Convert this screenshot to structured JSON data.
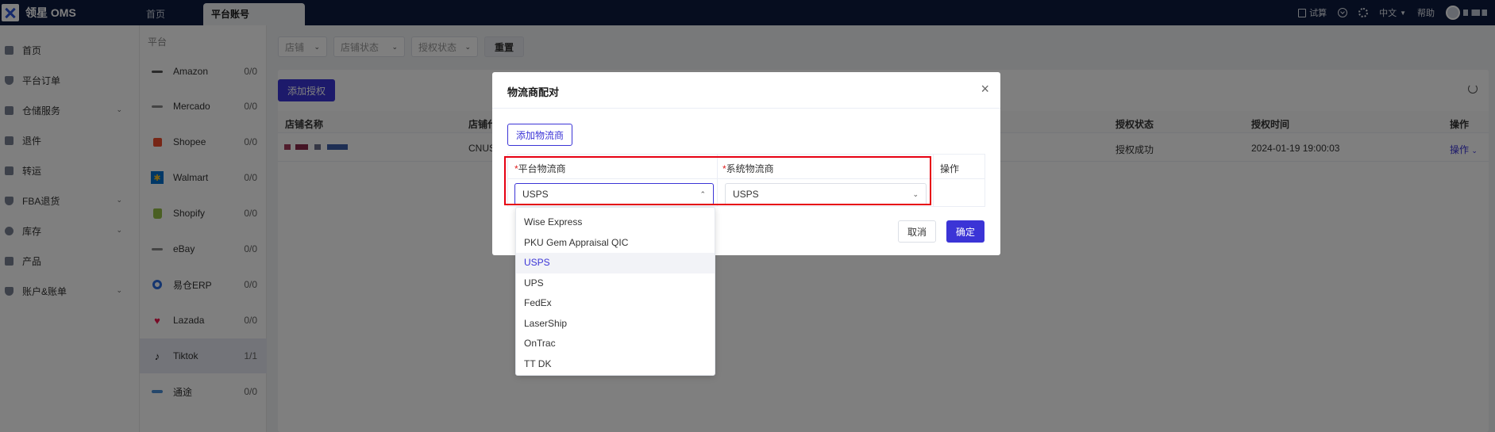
{
  "app": {
    "title": "领星 OMS"
  },
  "top_tabs": [
    {
      "label": "首页"
    },
    {
      "label": "平台账号"
    }
  ],
  "top_right": {
    "calc": "试算",
    "lang": "中文",
    "help": "帮助"
  },
  "nav": [
    {
      "label": "首页",
      "expandable": false
    },
    {
      "label": "平台订单",
      "expandable": false
    },
    {
      "label": "仓储服务",
      "expandable": true
    },
    {
      "label": "退件",
      "expandable": false
    },
    {
      "label": "转运",
      "expandable": false
    },
    {
      "label": "FBA退货",
      "expandable": true
    },
    {
      "label": "库存",
      "expandable": true
    },
    {
      "label": "产品",
      "expandable": false
    },
    {
      "label": "账户&账单",
      "expandable": true
    }
  ],
  "platforms": {
    "heading": "平台",
    "items": [
      {
        "name": "Amazon",
        "count": "0/0",
        "icon": "amazon-icon",
        "color": "#555555"
      },
      {
        "name": "Mercado",
        "count": "0/0",
        "icon": "mercado-icon",
        "color": "#777777"
      },
      {
        "name": "Shopee",
        "count": "0/0",
        "icon": "shopee-icon",
        "color": "#ee4d2d"
      },
      {
        "name": "Walmart",
        "count": "0/0",
        "icon": "walmart-icon",
        "color": "#0071ce"
      },
      {
        "name": "Shopify",
        "count": "0/0",
        "icon": "shopify-icon",
        "color": "#95bf47"
      },
      {
        "name": "eBay",
        "count": "0/0",
        "icon": "ebay-icon",
        "color": "#777777"
      },
      {
        "name": "易仓ERP",
        "count": "0/0",
        "icon": "eccang-icon",
        "color": "#2b6ce0"
      },
      {
        "name": "Lazada",
        "count": "0/0",
        "icon": "lazada-icon",
        "color": "#f0154d"
      },
      {
        "name": "Tiktok",
        "count": "1/1",
        "icon": "tiktok-icon",
        "color": "#111111"
      },
      {
        "name": "通途",
        "count": "0/0",
        "icon": "tongtu-icon",
        "color": "#4a8fd6"
      }
    ]
  },
  "filters": {
    "shop": "店铺",
    "shop_status": "店铺状态",
    "auth_status": "授权状态",
    "reset": "重置"
  },
  "toolbar": {
    "add_auth": "添加授权"
  },
  "table": {
    "headers": {
      "shop_name": "店铺名称",
      "shop_code": "店铺代",
      "auth_status": "授权状态",
      "auth_time": "授权时间",
      "action": "操作"
    },
    "row": {
      "code_prefix": "CNUS",
      "auth_status": "授权成功",
      "auth_time": "2024-01-19 19:00:03",
      "action": "操作"
    }
  },
  "modal": {
    "title": "物流商配对",
    "add_button": "添加物流商",
    "required_mark": "*",
    "col_platform": "平台物流商",
    "col_system": "系统物流商",
    "col_action": "操作",
    "platform_value": "USPS",
    "system_value": "USPS",
    "cancel": "取消",
    "confirm": "确定"
  },
  "dropdown": {
    "options": [
      "Wise Express",
      "PKU Gem Appraisal QIC",
      "USPS",
      "UPS",
      "FedEx",
      "LaserShip",
      "OnTrac",
      "TT DK"
    ],
    "selected": "USPS"
  },
  "colors": {
    "primary": "#3b34d6",
    "topbar": "#0d1b3e",
    "highlight": "#e60012"
  }
}
